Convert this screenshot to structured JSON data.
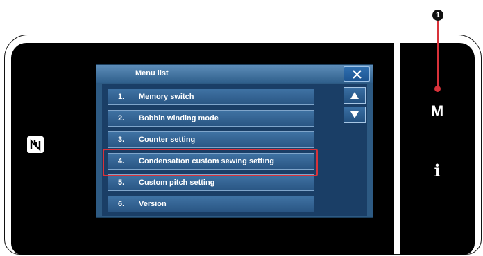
{
  "callout": {
    "number": "1"
  },
  "right_panel": {
    "m_key": "M",
    "info_key": "i"
  },
  "window": {
    "title": "Menu list",
    "close_icon": "close-icon",
    "items": [
      {
        "num": "1.",
        "label": "Memory switch"
      },
      {
        "num": "2.",
        "label": "Bobbin winding mode"
      },
      {
        "num": "3.",
        "label": "Counter setting"
      },
      {
        "num": "4.",
        "label": "Condensation custom sewing setting"
      },
      {
        "num": "5.",
        "label": "Custom pitch setting"
      },
      {
        "num": "6.",
        "label": "Version"
      }
    ],
    "selected_index": 3
  },
  "scroll": {
    "up_icon": "arrow-up-icon",
    "down_icon": "arrow-down-icon"
  },
  "colors": {
    "highlight": "#d8323a",
    "window": "#2d5a83",
    "button": "#3f72a3"
  }
}
